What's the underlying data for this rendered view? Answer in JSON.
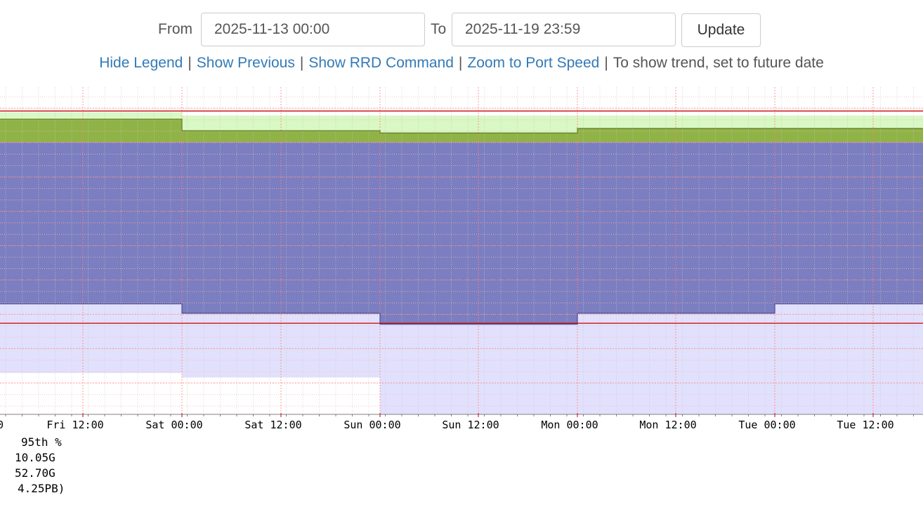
{
  "form": {
    "from_label": "From",
    "from_value": "2025-11-13 00:00",
    "to_label": "To",
    "to_value": "2025-11-19 23:59",
    "update_label": "Update"
  },
  "links": {
    "hide_legend": "Hide Legend",
    "show_previous": "Show Previous",
    "show_rrd_command": "Show RRD Command",
    "zoom_to_port_speed": "Zoom to Port Speed",
    "trend_note": "To show trend, set to future date",
    "separator": "|"
  },
  "chart_data": {
    "type": "area",
    "x_tick_labels": [
      "0",
      "Fri 12:00",
      "Sat 00:00",
      "Sat 12:00",
      "Sun 00:00",
      "Sun 12:00",
      "Mon 00:00",
      "Mon 12:00",
      "Tue 00:00",
      "Tue 12:00"
    ],
    "segments": [
      "Fri 00:00–Sat 00:00",
      "Sat 00:00–Sun 00:00",
      "Sun 00:00–Mon 00:00",
      "Mon 00:00–Tue 00:00",
      "Tue 00:00–Tue 18:00"
    ],
    "series": [
      {
        "label": "light-green band top (fraction of plot height)",
        "values": [
          0.935,
          0.925,
          0.925,
          0.925,
          0.925
        ]
      },
      {
        "label": "green area top (fraction of plot height)",
        "values": [
          0.914,
          0.878,
          0.871,
          0.885,
          0.885
        ]
      },
      {
        "label": "purple area bottom (fraction of plot height)",
        "values": [
          0.342,
          0.313,
          0.279,
          0.313,
          0.342
        ]
      },
      {
        "label": "lavender area bottom (fraction of plot height)",
        "values": [
          0.128,
          0.114,
          0,
          0,
          0
        ]
      }
    ],
    "reference_lines": [
      0.939,
      0.282
    ],
    "grid": true,
    "colors": {
      "light_green": "#d8f8c4",
      "green": "#8fb346",
      "green_line": "#5f7f28",
      "purple": "#7b7ec0",
      "purple_line": "#4a4e95",
      "lavender": "#e1e1fd",
      "red_line": "#cc0000",
      "grid_minor": "#ffb4b4",
      "grid_minor_alt": "#c8c8c8",
      "grid_major": "#ff8080"
    }
  },
  "legend": {
    "lines": [
      "95th %",
      "10.05G",
      "52.70G",
      "4.25PB)"
    ]
  }
}
